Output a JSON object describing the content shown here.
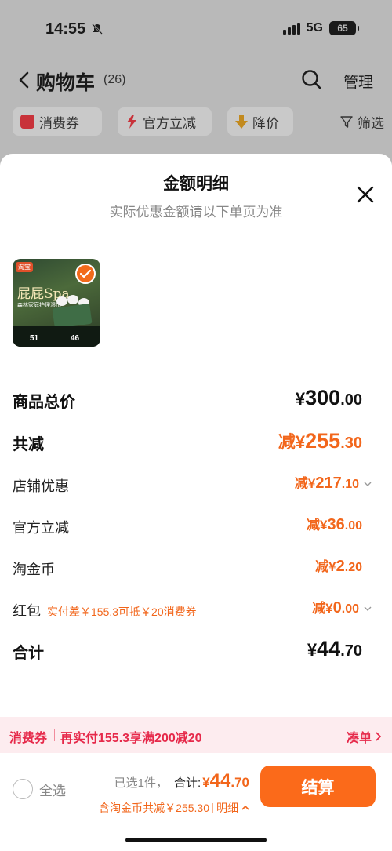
{
  "status": {
    "time": "14:55",
    "network": "5G",
    "battery": "65"
  },
  "nav": {
    "title": "购物车",
    "count": "(26)",
    "manage": "管理"
  },
  "chips": [
    {
      "label": "消费券"
    },
    {
      "label": "官方立减"
    },
    {
      "label": "降价"
    },
    {
      "label": "筛选"
    }
  ],
  "sheet": {
    "title": "金额明细",
    "subtitle": "实际优惠金额请以下单页为准"
  },
  "product": {
    "brand": "淘宝",
    "title": "屁屁Spa",
    "subtitle": "森林家庭护理湿巾",
    "price1": "51",
    "price2": "46"
  },
  "rows": {
    "total_price": {
      "label": "商品总价",
      "prefix": "¥",
      "int": "300",
      "dec": ".00"
    },
    "total_discount": {
      "label": "共减",
      "prefix": "减¥",
      "int": "255",
      "dec": ".30"
    },
    "shop_discount": {
      "label": "店铺优惠",
      "prefix": "减¥",
      "int": "217",
      "dec": ".10"
    },
    "official_discount": {
      "label": "官方立减",
      "prefix": "减¥",
      "int": "36",
      "dec": ".00"
    },
    "taojinbi": {
      "label": "淘金币",
      "prefix": "减¥",
      "int": "2",
      "dec": ".20"
    },
    "red_packet": {
      "label": "红包",
      "note": "实付差￥155.3可抵￥20消费券",
      "prefix": "减¥",
      "int": "0",
      "dec": ".00"
    },
    "subtotal": {
      "label": "合计",
      "prefix": "¥",
      "int": "44",
      "dec": ".70"
    }
  },
  "promo": {
    "tag": "消费券",
    "text": "再实付155.3享满200减20",
    "action": "凑单"
  },
  "bottom": {
    "select_all": "全选",
    "selected": "已选1件，",
    "total_label": "合计:",
    "total_prefix": "¥",
    "total_int": "44",
    "total_dec": ".70",
    "saving": "含淘金币共减￥255.30",
    "detail": "明细",
    "checkout": "结算"
  },
  "colors": {
    "accent": "#f2661b",
    "checkout": "#fb6a1a",
    "promo": "#e6294a"
  }
}
